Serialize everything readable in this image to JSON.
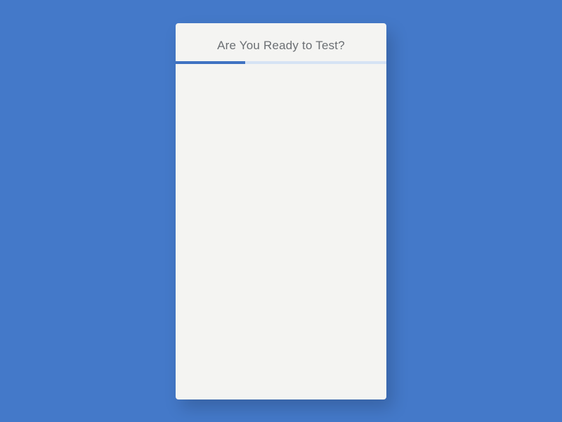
{
  "header": {
    "title": "Are You Ready to Test?"
  },
  "progress": {
    "percent": 33
  }
}
